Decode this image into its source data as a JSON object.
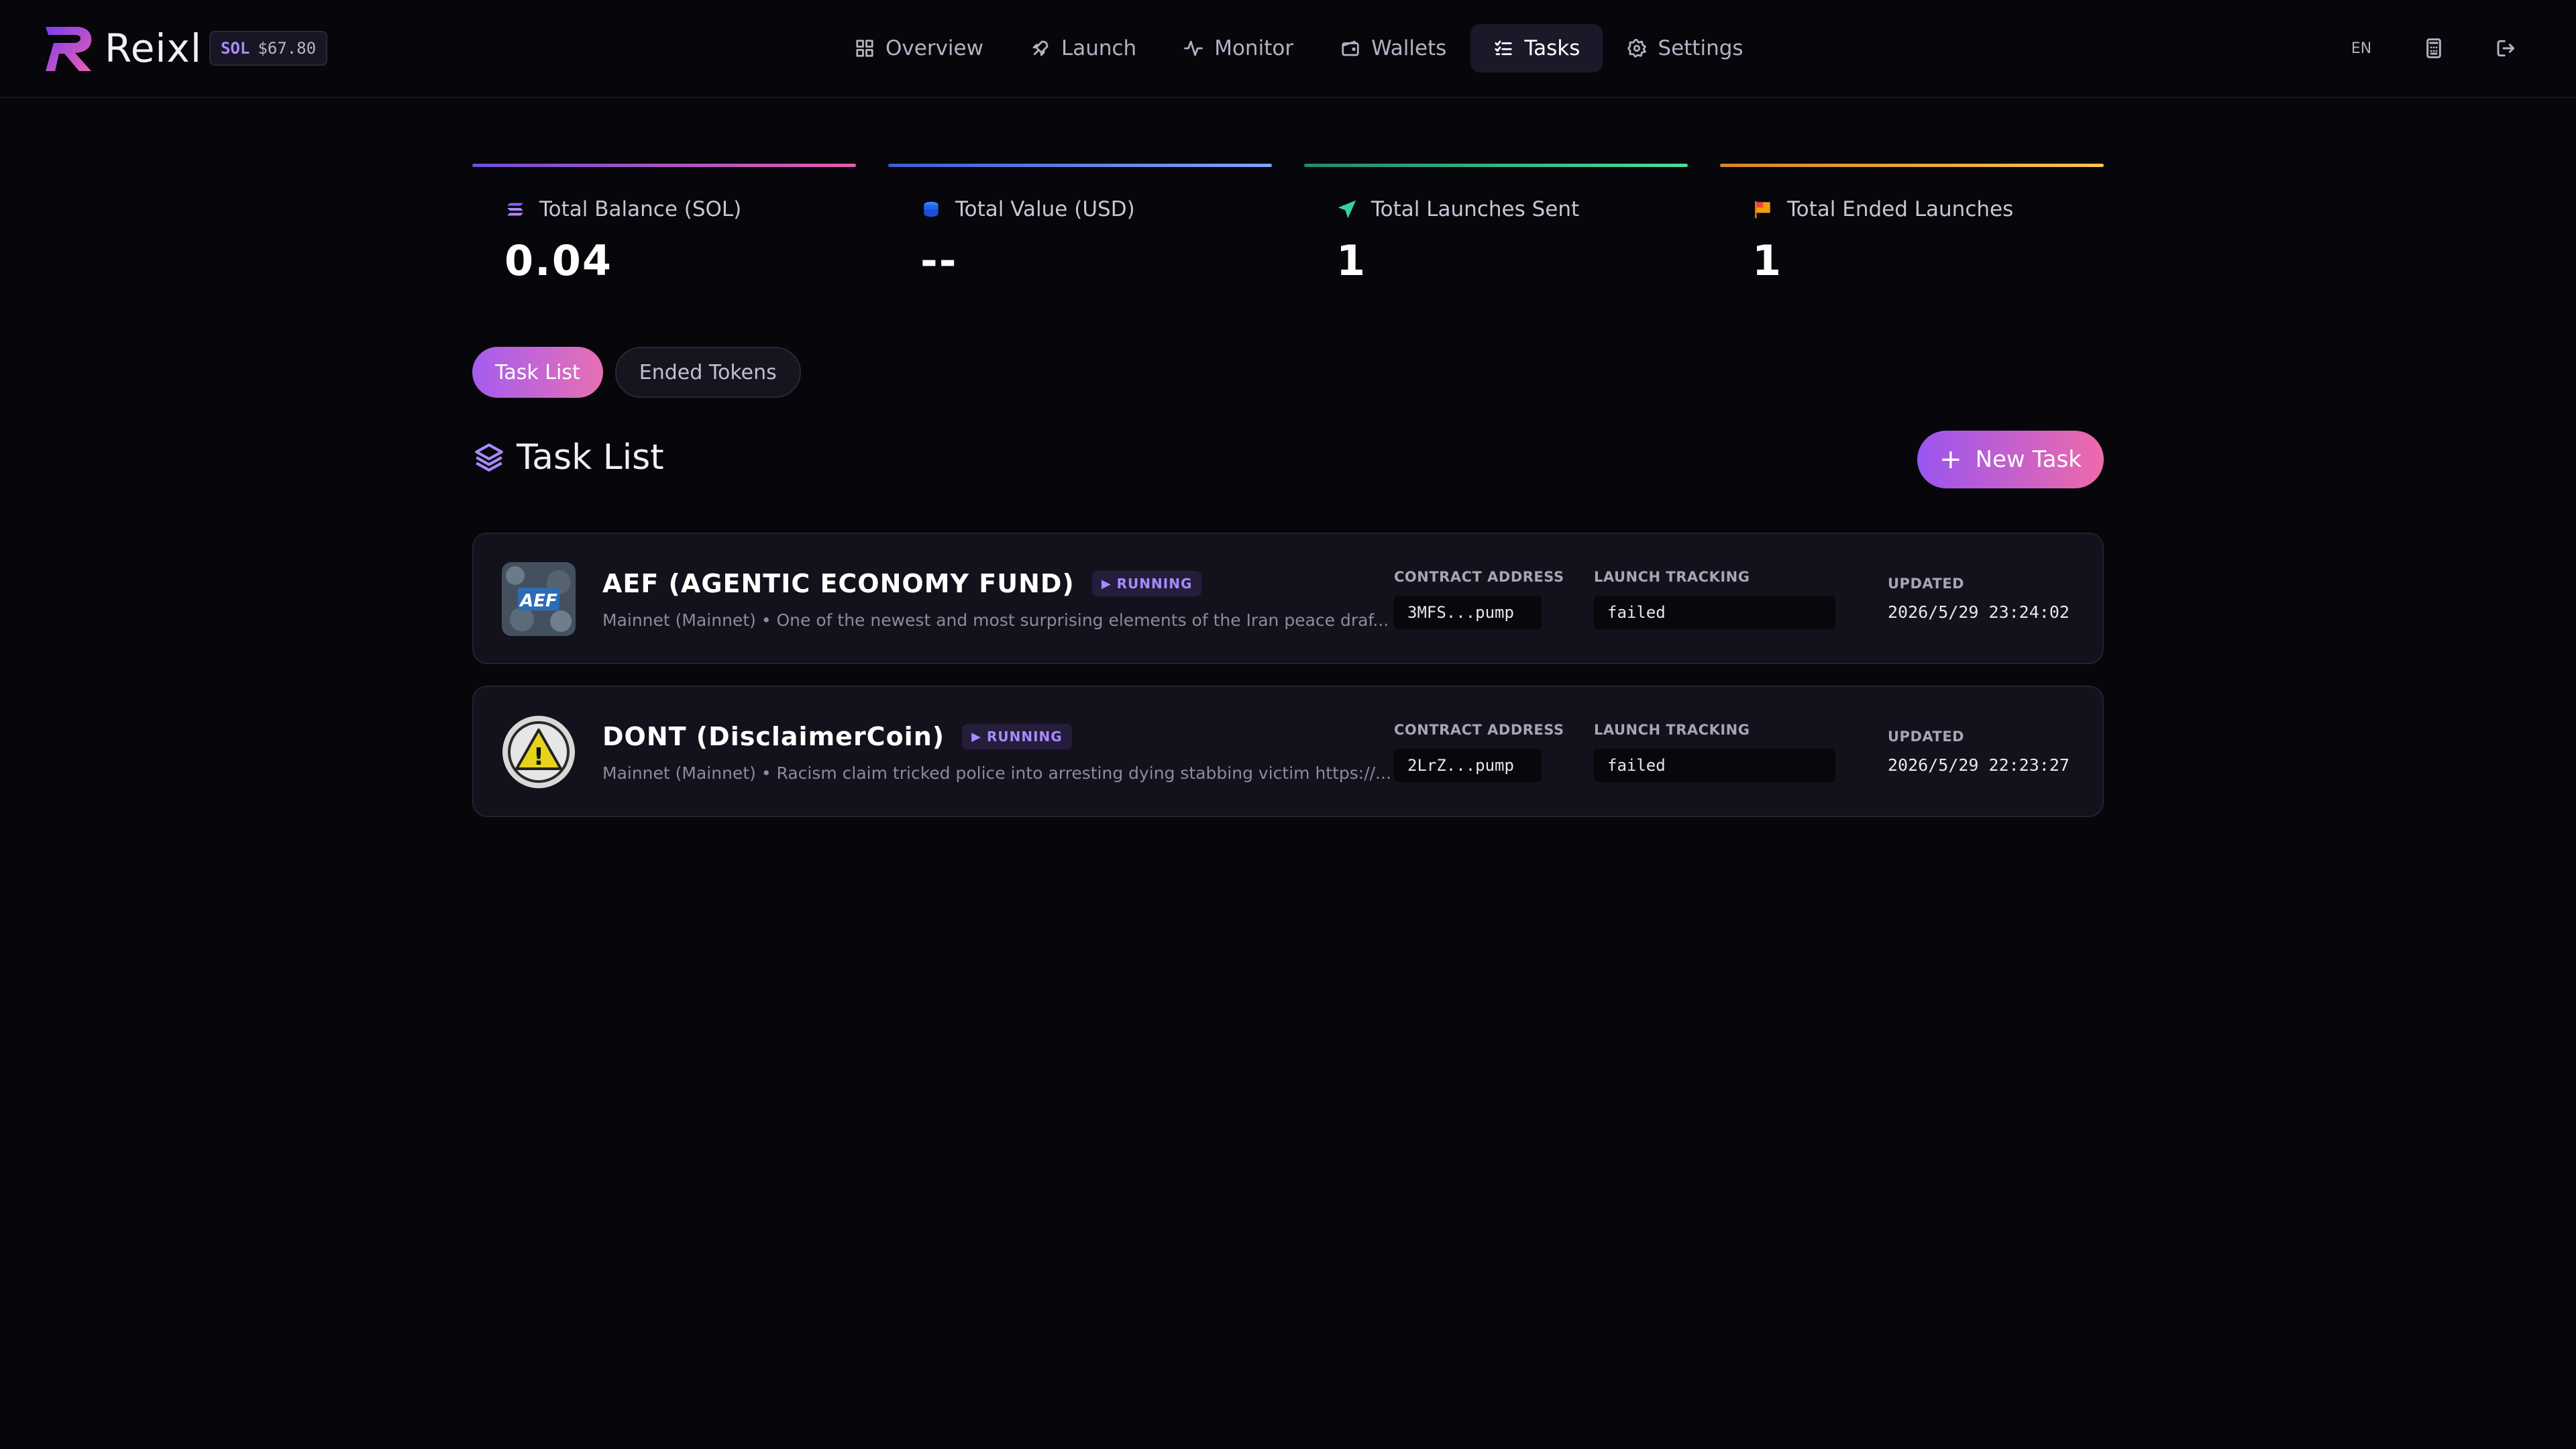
{
  "brand": {
    "name": "Reixl"
  },
  "price": {
    "symbol": "SOL",
    "value": "$67.80"
  },
  "nav": [
    {
      "label": "Overview",
      "icon": "grid-icon"
    },
    {
      "label": "Launch",
      "icon": "rocket-icon"
    },
    {
      "label": "Monitor",
      "icon": "activity-icon"
    },
    {
      "label": "Wallets",
      "icon": "wallet-icon"
    },
    {
      "label": "Tasks",
      "icon": "list-check-icon",
      "active": true
    },
    {
      "label": "Settings",
      "icon": "gear-icon"
    }
  ],
  "top_right": {
    "lang": "EN",
    "icons": [
      "calculator-icon",
      "logout-icon"
    ]
  },
  "stats": [
    {
      "label": "Total Balance (SOL)",
      "value": "0.04",
      "icon": "solana-icon",
      "bar": [
        "#6d4fd6",
        "#e85bb0"
      ]
    },
    {
      "label": "Total Value (USD)",
      "value": "--",
      "icon": "coins-icon",
      "bar": [
        "#3b5fcf",
        "#7aa7ff"
      ]
    },
    {
      "label": "Total Launches Sent",
      "value": "1",
      "icon": "send-icon",
      "bar": [
        "#1f8a6a",
        "#4ade9c"
      ]
    },
    {
      "label": "Total Ended Launches",
      "value": "1",
      "icon": "flag-icon",
      "bar": [
        "#d6852a",
        "#f7c64b"
      ]
    }
  ],
  "tabs": [
    {
      "label": "Task List",
      "active": true
    },
    {
      "label": "Ended Tokens",
      "active": false
    }
  ],
  "section": {
    "title": "Task List",
    "new_task_label": "New Task"
  },
  "fields": {
    "contract": "CONTRACT ADDRESS",
    "tracking": "LAUNCH TRACKING",
    "updated": "UPDATED"
  },
  "tasks": [
    {
      "name": "AEF (AGENTIC ECONOMY FUND)",
      "status": "RUNNING",
      "description": "Mainnet (Mainnet) • One of the newest and most surprising elements of the Iran peace draf...",
      "contract": "3MFS...pump",
      "tracking": "failed",
      "updated": "2026/5/29 23:24:02",
      "image_text": "AEF"
    },
    {
      "name": "DONT (DisclaimerCoin)",
      "status": "RUNNING",
      "description": "Mainnet (Mainnet) • Racism claim tricked police into arresting dying stabbing victim https://...",
      "contract": "2LrZ...pump",
      "tracking": "failed",
      "updated": "2026/5/29 22:23:27",
      "image_text": "!"
    }
  ],
  "colors": {
    "accent": "#a78bfa",
    "background": "#07060b",
    "card": "#13111b"
  }
}
